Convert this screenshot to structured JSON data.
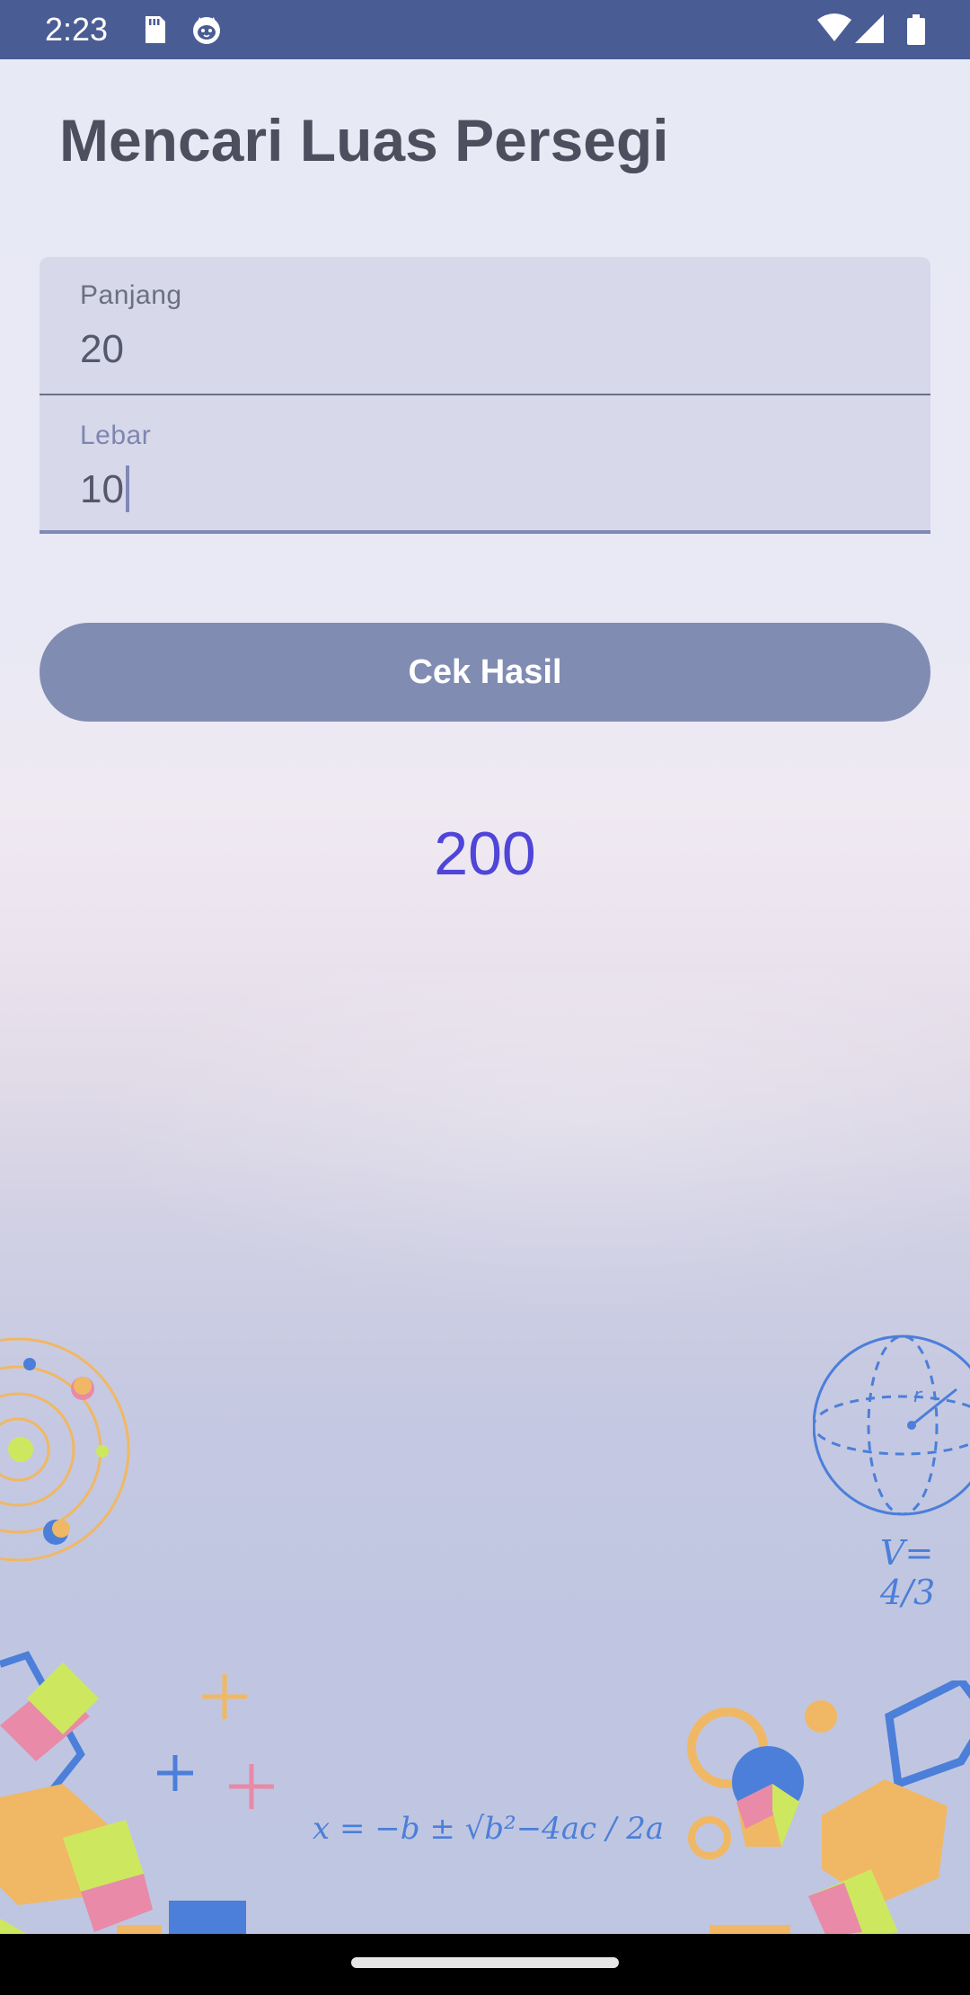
{
  "status_bar": {
    "time": "2:23",
    "left_icons": [
      "sd-card-icon",
      "cat-face-icon"
    ],
    "right_icons": [
      "wifi-icon",
      "signal-icon",
      "battery-icon"
    ],
    "background": "#4a5c94"
  },
  "page": {
    "title": "Mencari Luas Persegi"
  },
  "form": {
    "length_label": "Panjang",
    "length_value": "20",
    "width_label": "Lebar",
    "width_value": "10"
  },
  "actions": {
    "check_label": "Cek Hasil",
    "button_color": "#818cb3"
  },
  "result": {
    "value": "200",
    "color": "#4f45d8"
  },
  "decorations": {
    "formula_text": "x = −b ± √b²−4ac / 2a",
    "volume_text": "V= 4/3"
  }
}
